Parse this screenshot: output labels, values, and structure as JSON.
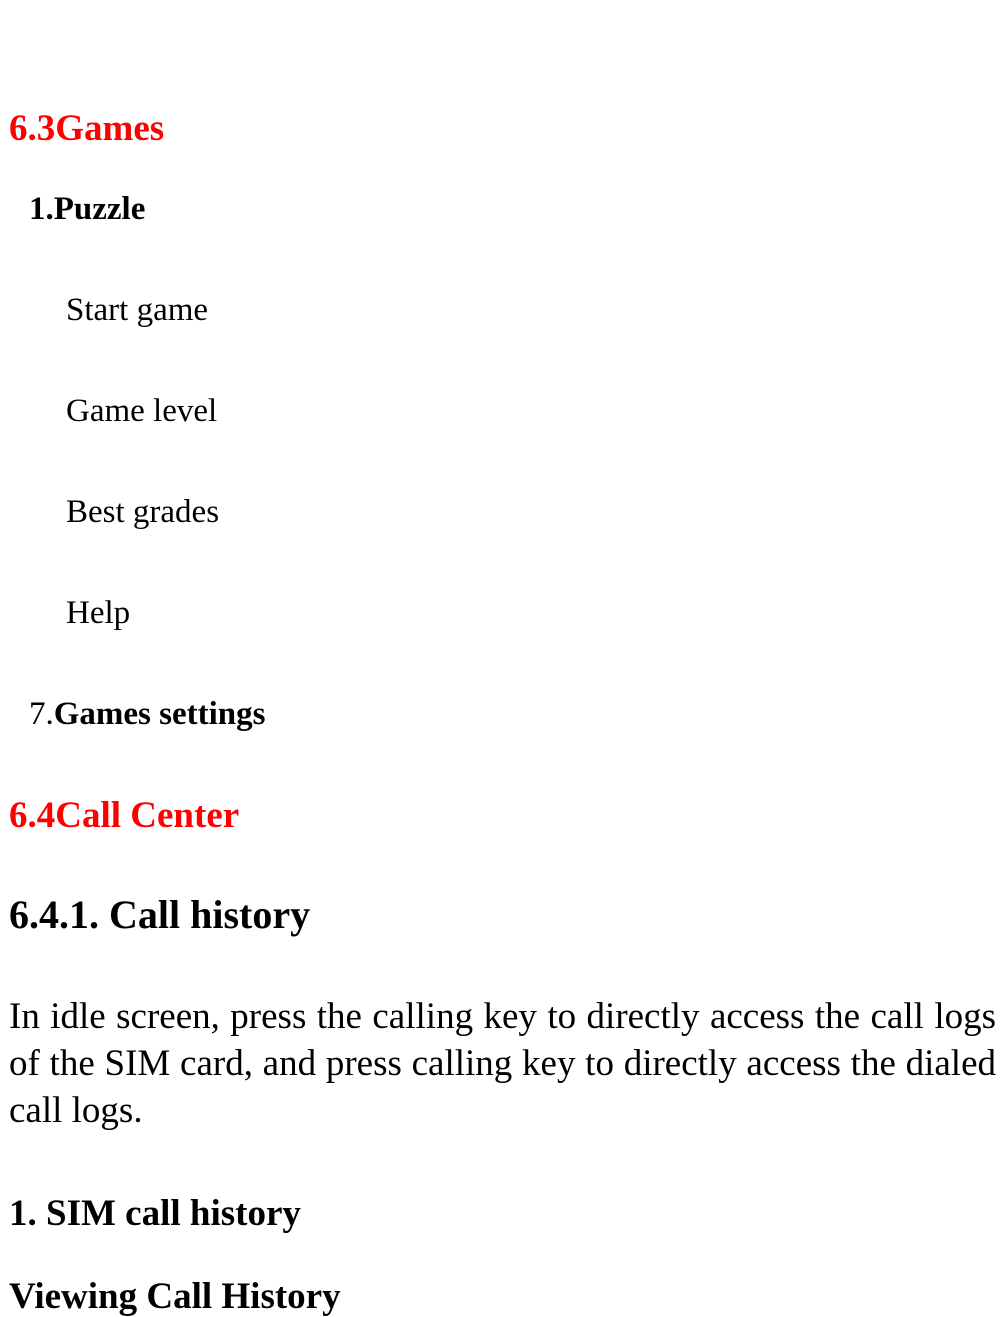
{
  "sections": {
    "games": {
      "heading": "6.3Games",
      "puzzle": {
        "title": "1.Puzzle",
        "items": [
          "Start game",
          "Game level",
          "Best grades",
          "Help"
        ]
      },
      "settings": {
        "number": "7.",
        "title": "Games settings"
      }
    },
    "call_center": {
      "heading": "6.4Call Center",
      "call_history": {
        "heading": "6.4.1. Call history",
        "paragraph": "In idle screen, press the calling key to directly access the call logs of the SIM card, and press calling key to directly access the dialed call logs.",
        "sim_heading": "1. SIM call history",
        "viewing_heading": "Viewing Call History"
      }
    }
  },
  "colors": {
    "heading_red": "#ff0000",
    "text": "#000000"
  }
}
